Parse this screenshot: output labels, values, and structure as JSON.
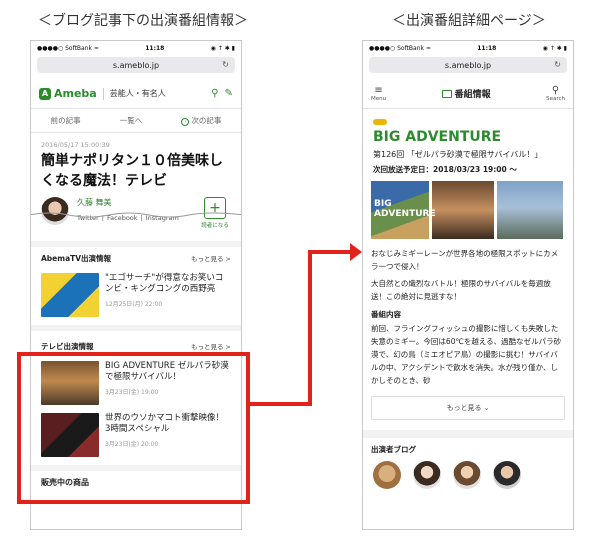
{
  "captions": {
    "left": "＜ブログ記事下の出演番組情報＞",
    "right": "＜出演番組詳細ページ＞"
  },
  "statusbar": {
    "carrier": "●●●●○ SoftBank ≈",
    "time": "11:18",
    "right": "◉ ↑ ✱ ▮"
  },
  "url": "s.ameblo.jp",
  "left_phone": {
    "logo": "Ameba",
    "category": "芸能人・有名人",
    "nav": {
      "prev": "前の記事",
      "list": "一覧へ",
      "next": "次の記事"
    },
    "post": {
      "date": "2016/05/17 15:00:39",
      "title": "簡単ナポリタン１０倍美味しくなる魔法！テレビ"
    },
    "profile": {
      "name": "久藤 舞美",
      "links": [
        "Twitter",
        "Facebook",
        "Instagram"
      ],
      "reader_label": "読者になる"
    },
    "abema": {
      "heading": "AbemaTV出演情報",
      "more": "もっと見る >",
      "item": {
        "title": "\"エゴサーチ\"が得意なお笑いコンビ・キングコングの西野亮",
        "date": "12月25日(月) 22:00"
      }
    },
    "tv": {
      "heading": "テレビ出演情報",
      "more": "もっと見る >",
      "items": [
        {
          "title": "BIG ADVENTURE ゼルパラ砂漠で極限サバイバル！",
          "date": "3月23日(金) 19:00"
        },
        {
          "title": "世界のウソかマコト衝撃映像！　3時間スペシャル",
          "date": "3月23日(金) 20:00"
        }
      ]
    },
    "bottom": "販売中の商品"
  },
  "right_phone": {
    "menu": "Menu",
    "search": "Search",
    "header_title": "番組情報",
    "show_name": "BIG ADVENTURE",
    "episode": "第126回 「ゼルパラ砂漠で極限サバイバル！」",
    "airdate": "次回放送予定日：2018/03/23 19:00 〜",
    "gallery_logo": "BIG ADVENTURE",
    "description": [
      "おなじみミギーレーンが世界各地の極限スポットにカメラ一つで侵入！",
      "大自然との熾烈なバトル！極限のサバイバルを毎週放送！この絶対に見逃すな！"
    ],
    "content_heading": "番組内容",
    "content": "前回、フライングフィッシュの撮影に惜しくも失敗した失意のミギー。今回は60℃を越える、過酷なゼルパラ砂漠で、幻の鳥（ミエオピア鳥）の撮影に挑む！サバイバルの中、アクシデントで飲水を消失。水が残り僅か、しかしそのとき、砂",
    "more": "もっと見る",
    "blog_heading": "出演者ブログ"
  }
}
